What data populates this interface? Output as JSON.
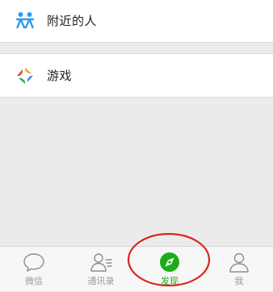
{
  "discover_list": {
    "nearby": {
      "label": "附近的人",
      "icon": "people-nearby-icon"
    },
    "games": {
      "label": "游戏",
      "icon": "games-icon"
    }
  },
  "tabbar": {
    "tabs": [
      {
        "label": "微信",
        "icon": "chat-bubble-icon",
        "active": false
      },
      {
        "label": "通讯录",
        "icon": "contacts-icon",
        "active": false
      },
      {
        "label": "发现",
        "icon": "compass-icon",
        "active": true
      },
      {
        "label": "我",
        "icon": "person-icon",
        "active": false
      }
    ]
  },
  "colors": {
    "accent": "#1aad19",
    "annotation": "#d9261c",
    "nearby_icon": "#2b9cf2"
  }
}
